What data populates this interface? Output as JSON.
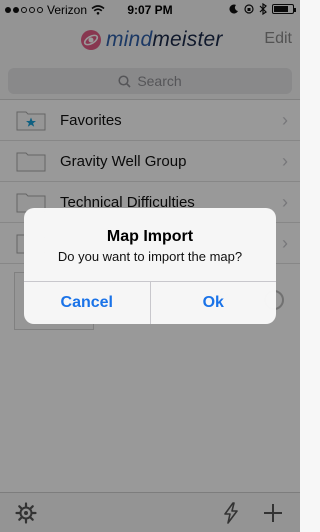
{
  "status_bar": {
    "carrier": "Verizon",
    "time": "9:07 PM"
  },
  "header": {
    "logo_text_part1": "mind",
    "logo_text_part2": "meister",
    "edit_label": "Edit"
  },
  "search": {
    "placeholder": "Search"
  },
  "list": {
    "items": [
      {
        "label": "Favorites",
        "icon": "star-folder-icon"
      },
      {
        "label": "Gravity Well Group",
        "icon": "folder-icon"
      },
      {
        "label": "Technical Difficulties",
        "icon": "folder-icon"
      }
    ]
  },
  "toolbar": {
    "settings_icon": "gear-icon",
    "sync_icon": "bolt-icon",
    "add_icon": "plus-icon"
  },
  "alert": {
    "title": "Map Import",
    "message": "Do you want to import the map?",
    "cancel_label": "Cancel",
    "ok_label": "Ok"
  },
  "colors": {
    "accent": "#1a73e8",
    "star": "#1aa0d8",
    "brand": "#2f5fa8"
  }
}
